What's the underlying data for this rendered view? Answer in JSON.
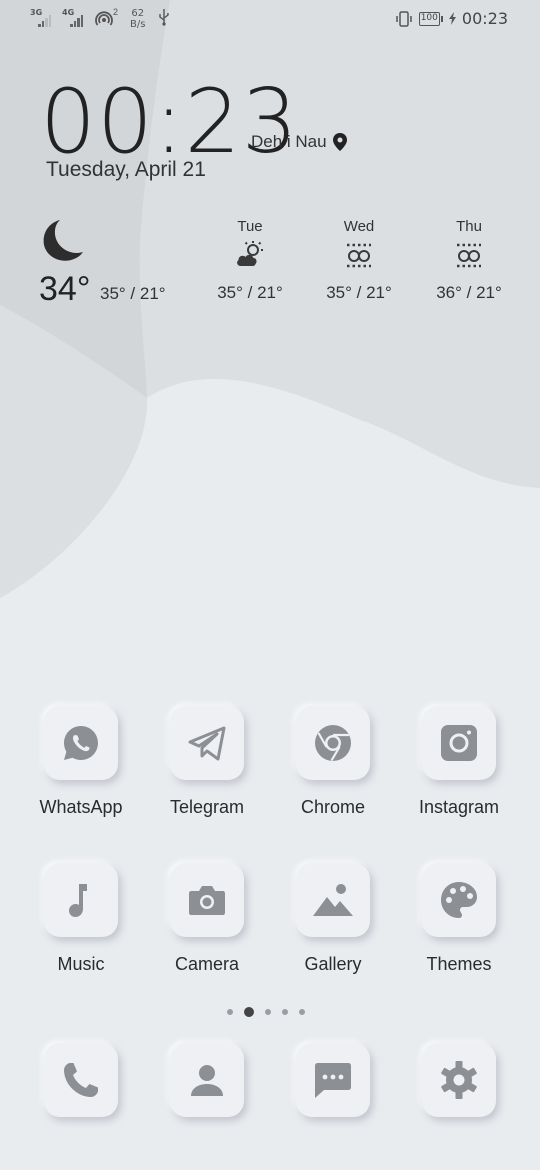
{
  "status_bar": {
    "sim1_network": "3G",
    "sim2_network": "4G",
    "hotspot_count": "2",
    "speed_value": "62",
    "speed_unit": "B/s",
    "battery": "100",
    "time": "00:23"
  },
  "clock": {
    "time": "00:23",
    "location": "Deh i Nau",
    "date": "Tuesday, April 21"
  },
  "weather": {
    "current": {
      "icon": "moon-icon",
      "temp": "34°",
      "range": "35° / 21°"
    },
    "forecast": [
      {
        "day": "Tue",
        "icon": "partly-cloudy-icon",
        "range": "35° / 21°"
      },
      {
        "day": "Wed",
        "icon": "haze-icon",
        "range": "35° / 21°"
      },
      {
        "day": "Thu",
        "icon": "haze-icon",
        "range": "36° / 21°"
      }
    ]
  },
  "apps": [
    {
      "label": "WhatsApp",
      "icon": "whatsapp-icon"
    },
    {
      "label": "Telegram",
      "icon": "telegram-icon"
    },
    {
      "label": "Chrome",
      "icon": "chrome-icon"
    },
    {
      "label": "Instagram",
      "icon": "instagram-icon"
    },
    {
      "label": "Music",
      "icon": "music-icon"
    },
    {
      "label": "Camera",
      "icon": "camera-icon"
    },
    {
      "label": "Gallery",
      "icon": "gallery-icon"
    },
    {
      "label": "Themes",
      "icon": "palette-icon"
    }
  ],
  "dock": [
    {
      "icon": "phone-icon"
    },
    {
      "icon": "contacts-icon"
    },
    {
      "icon": "messages-icon"
    },
    {
      "icon": "settings-icon"
    }
  ],
  "page_indicator": {
    "pages": 5,
    "current": 2
  },
  "colors": {
    "background": "#e9ecef",
    "wallpaper_shape": "#dcdfe2",
    "wallpaper_shape_dark": "#d3d6d9",
    "icon_gray": "#8c8f94"
  }
}
